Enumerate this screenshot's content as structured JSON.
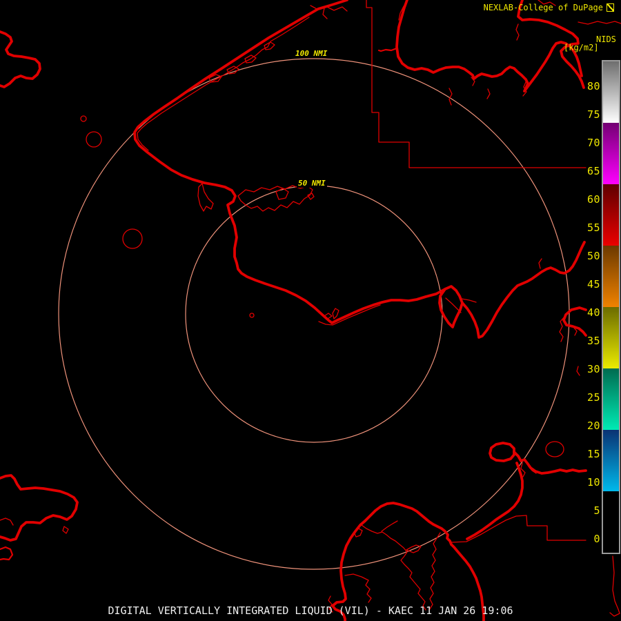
{
  "header": {
    "title": "NEXLAB-College of DuPage",
    "logo_icon": "dupage-glyph-icon"
  },
  "colorbar": {
    "title": "NIDS",
    "units": "[kg/m2]",
    "label_color": "#F0E800",
    "tick_labels": [
      "80",
      "75",
      "70",
      "65",
      "60",
      "55",
      "50",
      "45",
      "40",
      "35",
      "30",
      "25",
      "20",
      "15",
      "10",
      "5",
      "0"
    ],
    "segments": [
      {
        "from": 85,
        "to": 74,
        "top": "#6E6E6E",
        "bottom": "#FFFFFF"
      },
      {
        "from": 74,
        "to": 63,
        "top": "#730073",
        "bottom": "#FF00FF"
      },
      {
        "from": 63,
        "to": 52,
        "top": "#5E0000",
        "bottom": "#EB0000"
      },
      {
        "from": 52,
        "to": 41,
        "top": "#6B3900",
        "bottom": "#F08200"
      },
      {
        "from": 41,
        "to": 30,
        "top": "#6B6B00",
        "bottom": "#EBEB00"
      },
      {
        "from": 30,
        "to": 19,
        "top": "#006B50",
        "bottom": "#00EBB4"
      },
      {
        "from": 19,
        "to": 8,
        "top": "#0A3273",
        "bottom": "#00B9EB"
      },
      {
        "from": 8,
        "to": -3,
        "top": "#000000",
        "bottom": "#000000"
      }
    ]
  },
  "range_rings": {
    "color": "#F0937B",
    "labels": {
      "inner": "50 NMI",
      "outer": "100 NMI"
    }
  },
  "map": {
    "outline_color": "#E10000"
  },
  "caption": {
    "text": "DIGITAL VERTICALLY INTEGRATED LIQUID (VIL) - KAEC 11 JAN 26 19:06",
    "color": "#F0F0F0"
  },
  "background": "#000000"
}
